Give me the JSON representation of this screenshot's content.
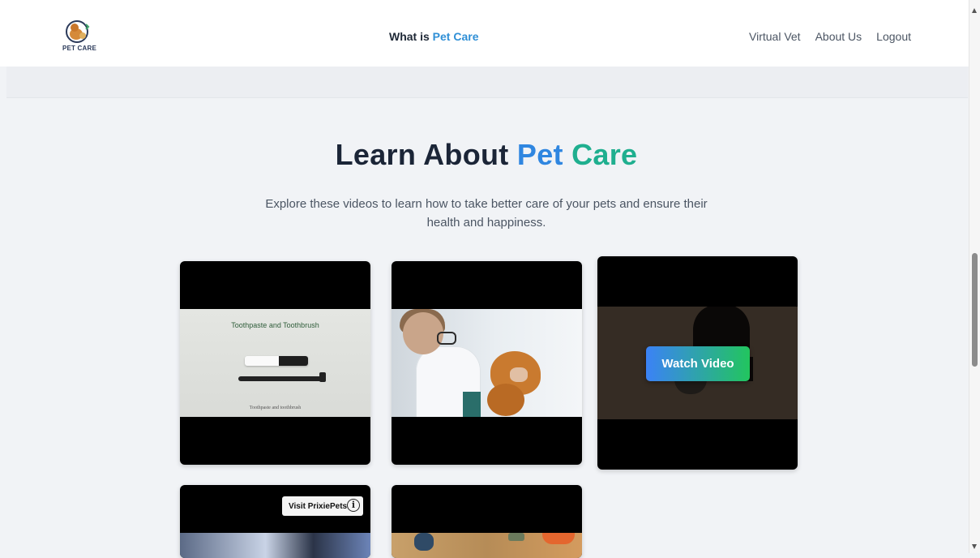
{
  "nav": {
    "logo_text": "PET CARE",
    "center_prefix": "What is",
    "center_accent": "Pet Care",
    "links": [
      "Virtual Vet",
      "About Us",
      "Logout"
    ]
  },
  "hero": {
    "title_prefix": "Learn About",
    "title_word1": "Pet",
    "title_word2": "Care",
    "subtitle": "Explore these videos to learn how to take better care of your pets and ensure their health and happiness."
  },
  "videos": [
    {
      "thumb_title": "Toothpaste and Toothbrush",
      "thumb_caption": "Toothpaste and toothbrush"
    },
    {},
    {
      "button_label": "Watch Video"
    },
    {
      "overlay_label": "Visit PrixiePets",
      "overlay_icon": "info-icon"
    },
    {}
  ],
  "colors": {
    "accent_blue": "#2f86e0",
    "accent_green": "#1faf8f",
    "button_gradient_start": "#3b82f6",
    "button_gradient_end": "#22c55e",
    "page_background": "#f1f3f6"
  },
  "scrollbar": {
    "position_fraction": 0.55
  }
}
